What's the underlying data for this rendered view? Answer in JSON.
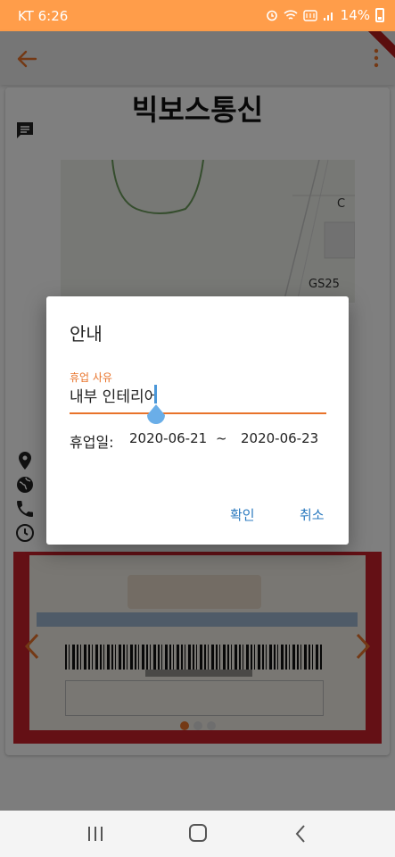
{
  "status_bar": {
    "carrier_time": "KT 6:26",
    "battery_percent": "14%",
    "icons": [
      "alarm-icon",
      "wifi-icon",
      "volte-icon",
      "signal-icon",
      "battery-icon"
    ]
  },
  "app_bar": {
    "back_icon": "arrow-back-icon",
    "menu_icon": "more-vert-icon"
  },
  "store": {
    "name": "빅보스통신",
    "map_labels": [
      "C",
      "GS25"
    ]
  },
  "banner": {
    "page_count": 3,
    "active_page": 0
  },
  "dialog": {
    "title": "안내",
    "field_label": "휴업 사유",
    "field_value": "내부 인테리어",
    "date_label": "휴업일:",
    "start_date": "2020-06-21",
    "separator": "~",
    "end_date": "2020-06-23",
    "confirm_label": "확인",
    "cancel_label": "취소"
  },
  "colors": {
    "status_bar": "#ff9d4a",
    "accent": "#e8732a",
    "button_text": "#2d7bc0",
    "banner_red": "#c8202b"
  },
  "nav_bar": {
    "icons": [
      "recent-apps-icon",
      "home-icon",
      "back-icon"
    ]
  }
}
